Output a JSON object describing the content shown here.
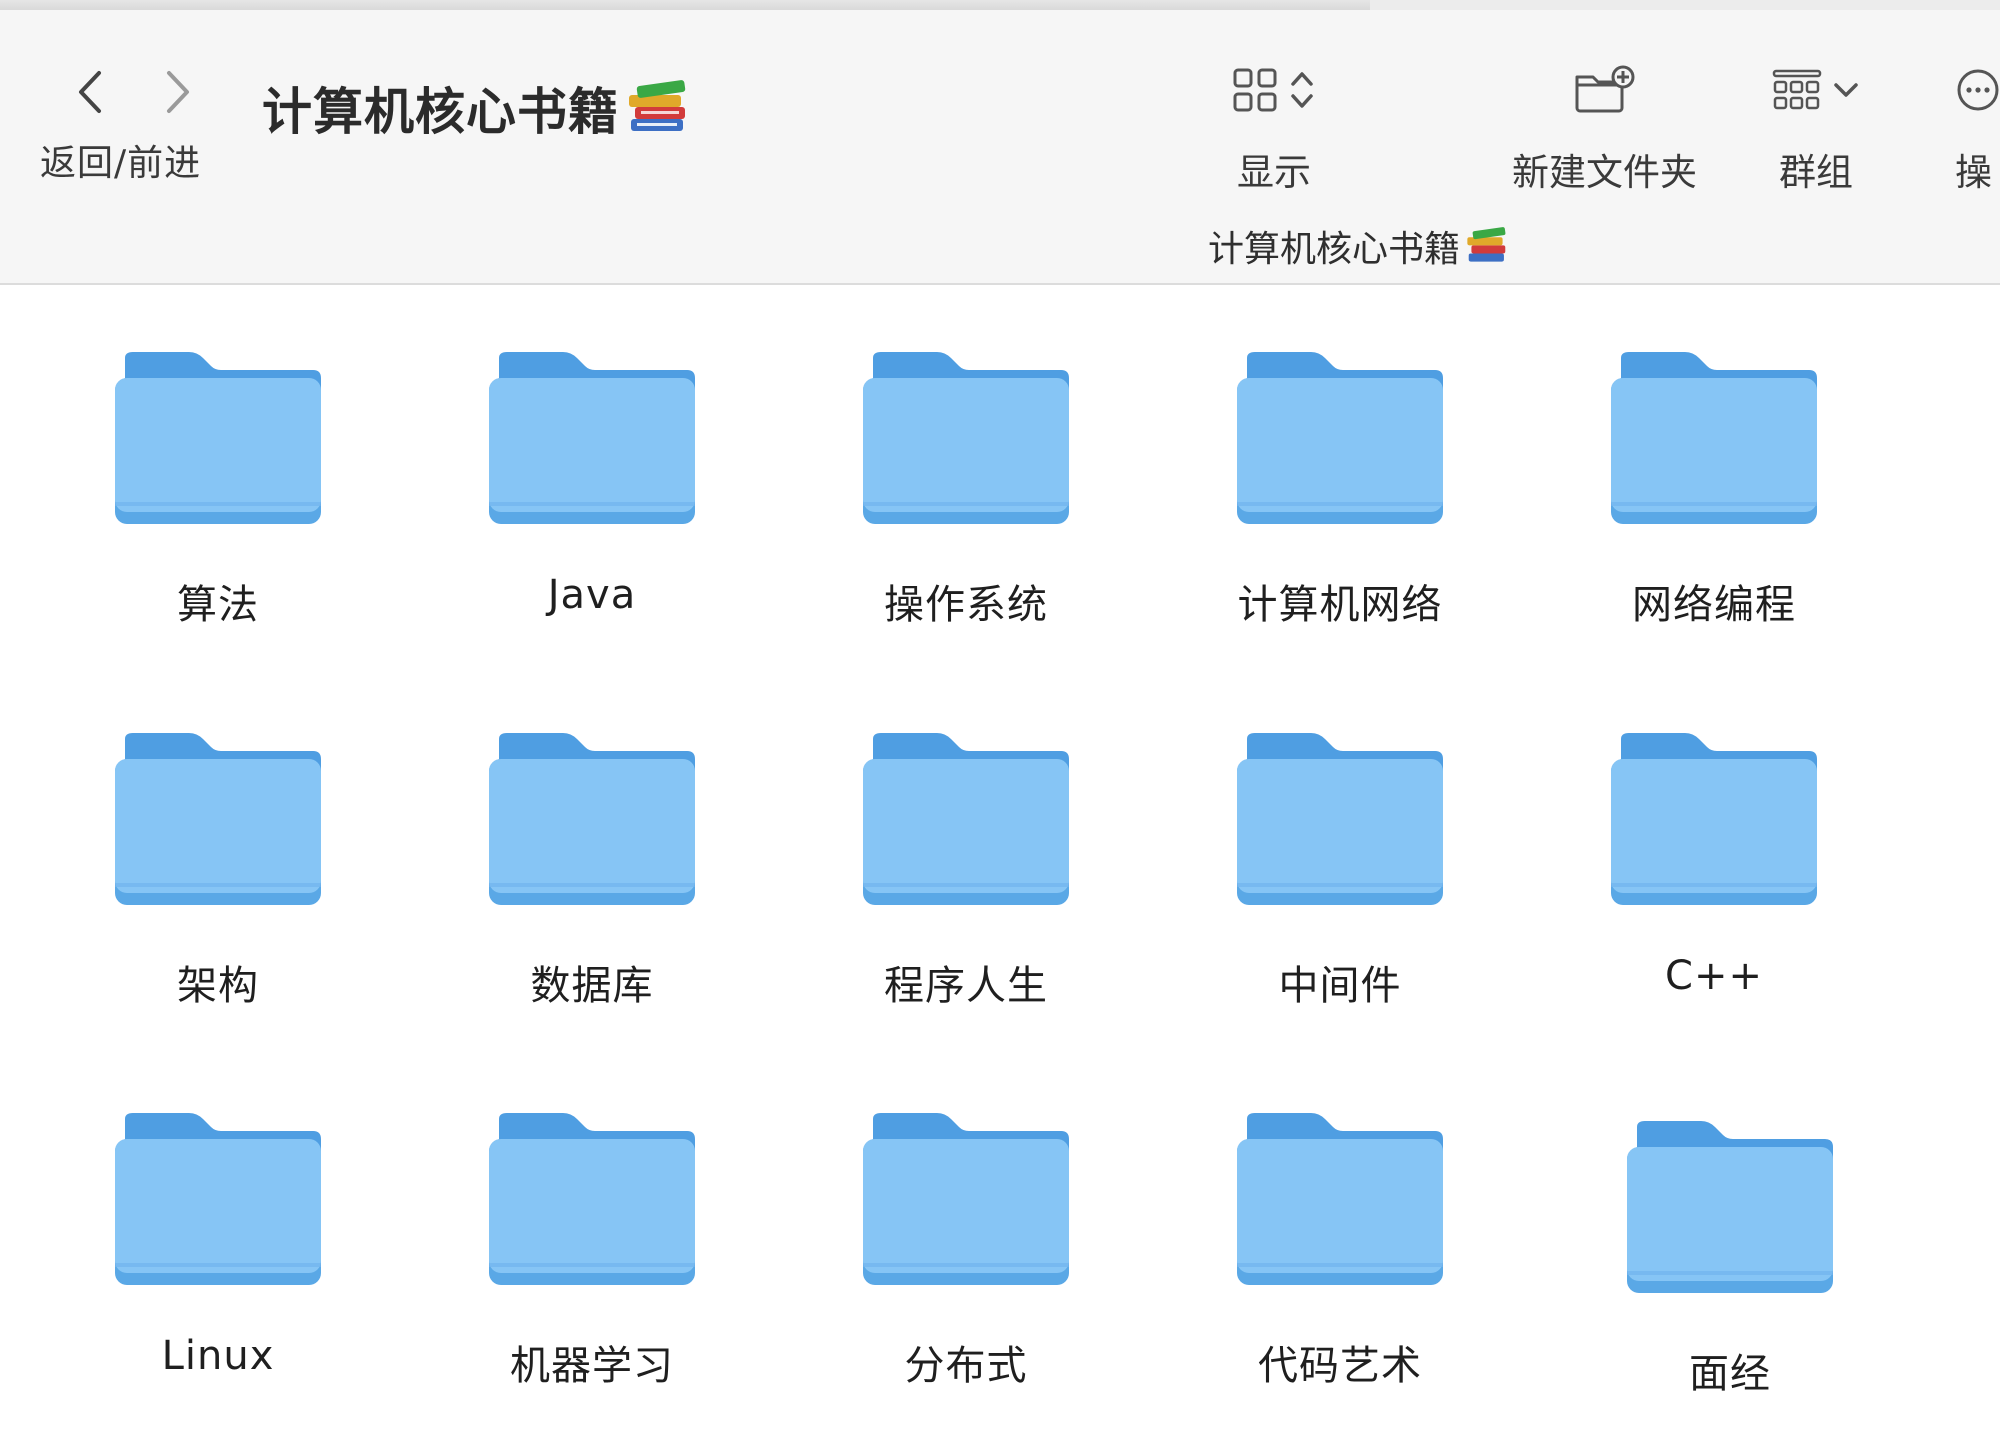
{
  "toolbar": {
    "nav_label": "返回/前进",
    "title": "计算机核心书籍",
    "title_icon": "books-emoji",
    "view_label": "显示",
    "new_folder_label": "新建文件夹",
    "group_label": "群组",
    "action_label": "操",
    "path_label": "计算机核心书籍"
  },
  "colors": {
    "folder_back": "#4f9ee2",
    "folder_front": "#86c5f5",
    "folder_bottom": "#5aa8e6",
    "toolbar_bg": "#f6f6f6"
  },
  "folders": [
    {
      "label": "算法"
    },
    {
      "label": "Java"
    },
    {
      "label": "操作系统"
    },
    {
      "label": "计算机网络"
    },
    {
      "label": "网络编程"
    },
    {
      "label": "架构"
    },
    {
      "label": "数据库"
    },
    {
      "label": "程序人生"
    },
    {
      "label": "中间件"
    },
    {
      "label": "C++"
    },
    {
      "label": "Linux"
    },
    {
      "label": "机器学习"
    },
    {
      "label": "分布式"
    },
    {
      "label": "代码艺术"
    },
    {
      "label": "面经"
    }
  ]
}
